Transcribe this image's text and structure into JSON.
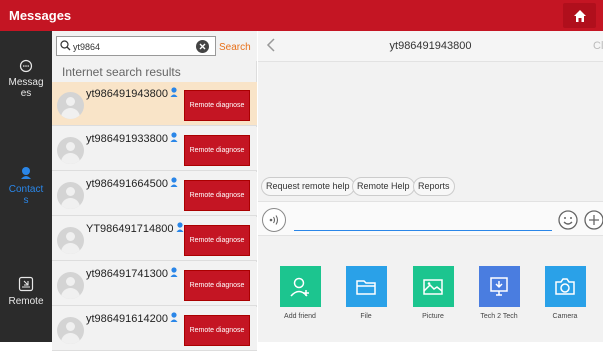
{
  "header": {
    "title": "Messages",
    "home_icon": "home-icon"
  },
  "sidebar": {
    "items": [
      {
        "label": "Messages",
        "icon": "chat-bubble-icon",
        "active": false
      },
      {
        "label": "Contacts",
        "icon": "contact-person-icon",
        "active": true
      },
      {
        "label": "Remote",
        "icon": "remote-screen-icon",
        "active": false
      }
    ]
  },
  "search": {
    "value": "yt9864",
    "button_label": "Search"
  },
  "results": {
    "section_title": "Internet search results",
    "button_label": "Remote diagnose",
    "items": [
      {
        "name": "yt986491943800",
        "selected": true
      },
      {
        "name": "yt986491933800",
        "selected": false
      },
      {
        "name": "yt986491664500",
        "selected": false
      },
      {
        "name": "YT986491714800",
        "selected": false
      },
      {
        "name": "yt986491741300",
        "selected": false
      },
      {
        "name": "yt986491614200",
        "selected": false
      }
    ]
  },
  "chat": {
    "back_icon": "back-arrow-icon",
    "peer_name": "yt986491943800",
    "clear_label": "Clear",
    "quick_replies": [
      "Request remote help",
      "Remote Help",
      "Reports"
    ],
    "message_value": "",
    "tools": [
      {
        "label": "Add friend",
        "icon": "add-friend-icon",
        "color": "#1cc58f"
      },
      {
        "label": "File",
        "icon": "folder-icon",
        "color": "#2aa1e8"
      },
      {
        "label": "Picture",
        "icon": "picture-icon",
        "color": "#1cc58f"
      },
      {
        "label": "Tech 2 Tech",
        "icon": "tech-monitor-icon",
        "color": "#4a7de0"
      },
      {
        "label": "Camera",
        "icon": "camera-icon",
        "color": "#2aa1e8"
      }
    ]
  },
  "colors": {
    "brand_red": "#c41523",
    "accent_blue": "#2a86e8",
    "search_orange": "#e8701a"
  }
}
